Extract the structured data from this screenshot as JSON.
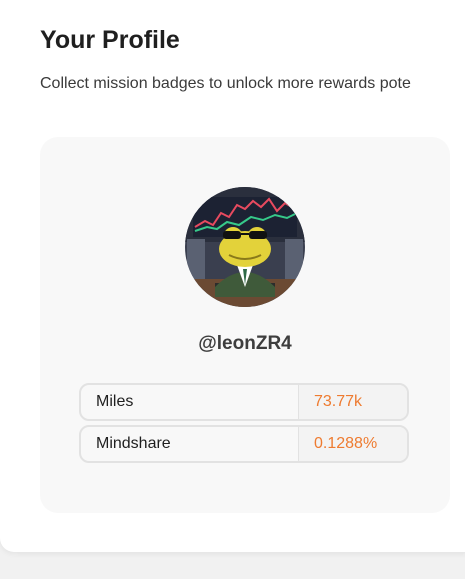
{
  "profile": {
    "title": "Your Profile",
    "subtitle": "Collect mission badges to unlock more rewards pote",
    "username": "@leonZR4",
    "avatar_icon": "frog-trader-avatar",
    "stats": [
      {
        "label": "Miles",
        "value": "73.77k"
      },
      {
        "label": "Mindshare",
        "value": "0.1288%"
      }
    ]
  },
  "colors": {
    "accent": "#ee7b30",
    "card_bg": "#f8f8f8",
    "page_bg": "#f1f1f1"
  }
}
